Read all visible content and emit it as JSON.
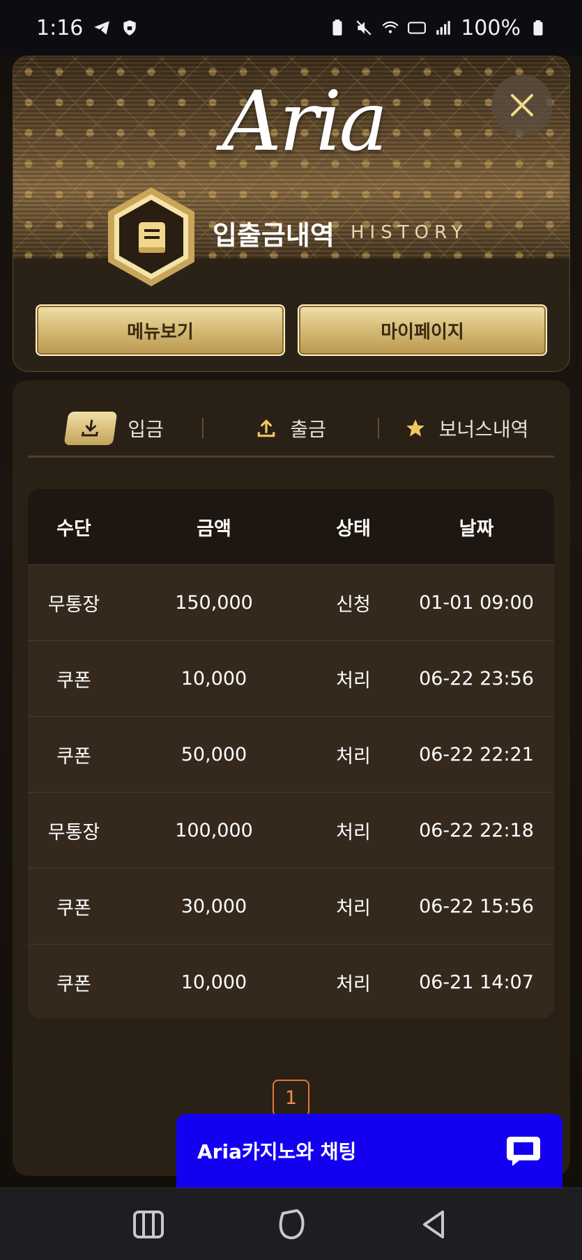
{
  "status_bar": {
    "time": "1:16",
    "battery": "100%"
  },
  "header": {
    "logo_text": "Aria",
    "title": "입출금내역",
    "subtitle": "HISTORY",
    "buttons": {
      "menu": "메뉴보기",
      "mypage": "마이페이지"
    }
  },
  "tabs": [
    {
      "label": "입금",
      "icon": "download-icon",
      "active": true
    },
    {
      "label": "출금",
      "icon": "upload-icon",
      "active": false
    },
    {
      "label": "보너스내역",
      "icon": "star-icon",
      "active": false
    }
  ],
  "table": {
    "headers": [
      "수단",
      "금액",
      "상태",
      "날짜"
    ],
    "rows": [
      [
        "무통장",
        "150,000",
        "신청",
        "01-01 09:00"
      ],
      [
        "쿠폰",
        "10,000",
        "처리",
        "06-22 23:56"
      ],
      [
        "쿠폰",
        "50,000",
        "처리",
        "06-22 22:21"
      ],
      [
        "무통장",
        "100,000",
        "처리",
        "06-22 22:18"
      ],
      [
        "쿠폰",
        "30,000",
        "처리",
        "06-22 15:56"
      ],
      [
        "쿠폰",
        "10,000",
        "처리",
        "06-21 14:07"
      ]
    ]
  },
  "pagination": {
    "current": "1"
  },
  "chat": {
    "label": "Aria카지노와 채팅"
  },
  "colors": {
    "gold": "#d7bd7a",
    "chat_blue": "#1400f0",
    "page_accent": "#ff8a45"
  }
}
